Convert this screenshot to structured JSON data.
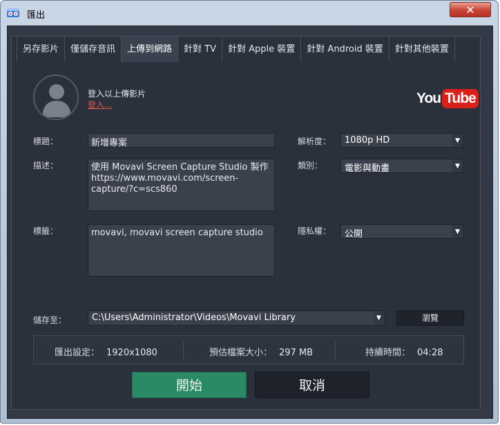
{
  "window": {
    "title": "匯出",
    "close_label": "✕"
  },
  "tabs": [
    {
      "label": "另存影片"
    },
    {
      "label": "僅儲存音訊"
    },
    {
      "label": "上傳到網路"
    },
    {
      "label": "針對 TV"
    },
    {
      "label": "針對 Apple 裝置"
    },
    {
      "label": "針對 Android 裝置"
    },
    {
      "label": "針對其他裝置"
    }
  ],
  "account": {
    "hint": "登入以上傳影片",
    "login_link": "登入..."
  },
  "logo": {
    "you": "You",
    "tube": "Tube"
  },
  "form": {
    "title_label": "標題：",
    "title_value": "新增專案",
    "desc_label": "描述：",
    "desc_value": "使用 Movavi Screen Capture Studio 製作\nhttps://www.movavi.com/screen-\ncapture/?c=scs860",
    "tags_label": "標籤：",
    "tags_value": "movavi, movavi screen capture studio",
    "resolution_label": "解析度：",
    "resolution_value": "1080p HD",
    "category_label": "類別：",
    "category_value": "電影與動畫",
    "privacy_label": "隱私權：",
    "privacy_value": "公開",
    "saveto_label": "儲存至：",
    "saveto_value": "C:\\Users\\Administrator\\Videos\\Movavi Library",
    "browse_label": "瀏覽"
  },
  "info": {
    "settings_label": "匯出設定：",
    "settings_value": "1920x1080",
    "size_label": "預估檔案大小：",
    "size_value": "297 MB",
    "duration_label": "持續時間：",
    "duration_value": "04:28"
  },
  "actions": {
    "start_label": "開始",
    "cancel_label": "取消"
  },
  "colors": {
    "accent": "#2a8a66",
    "link": "#e0534a",
    "youtube": "#d8211b",
    "background": "#2b313c"
  }
}
